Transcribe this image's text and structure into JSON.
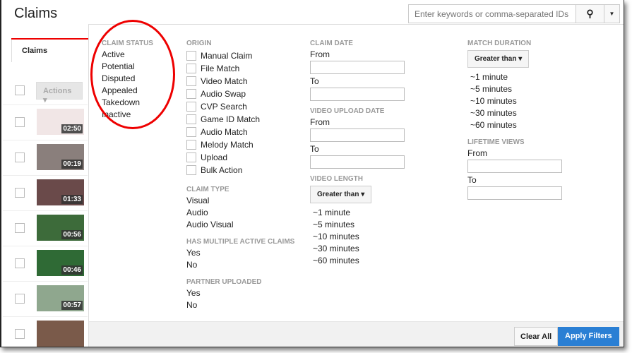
{
  "header": {
    "title": "Claims",
    "search_placeholder": "Enter keywords or comma-separated IDs",
    "search_icon": "search-icon",
    "dropdown_icon": "caret-down-icon"
  },
  "tabs": [
    {
      "label": "Claims"
    }
  ],
  "list": {
    "actions_label": "Actions ▾",
    "rows": [
      {
        "duration": "02:50",
        "color": "#f1e6e6"
      },
      {
        "duration": "00:19",
        "color": "#8a7f7c"
      },
      {
        "duration": "01:33",
        "color": "#6a4a4a"
      },
      {
        "duration": "00:56",
        "color": "#3d6b3a"
      },
      {
        "duration": "00:46",
        "color": "#2f6a35"
      },
      {
        "duration": "00:57",
        "color": "#8fa78e"
      },
      {
        "duration": "",
        "color": "#7a5a4a"
      }
    ]
  },
  "filters": {
    "claim_status": {
      "heading": "CLAIM STATUS",
      "items": [
        "Active",
        "Potential",
        "Disputed",
        "Appealed",
        "Takedown",
        "Inactive"
      ]
    },
    "origin": {
      "heading": "ORIGIN",
      "items": [
        "Manual Claim",
        "File Match",
        "Video Match",
        "Audio Swap",
        "CVP Search",
        "Game ID Match",
        "Audio Match",
        "Melody Match",
        "Upload",
        "Bulk Action"
      ]
    },
    "claim_type": {
      "heading": "CLAIM TYPE",
      "items": [
        "Visual",
        "Audio",
        "Audio Visual"
      ]
    },
    "multiple_active": {
      "heading": "HAS MULTIPLE ACTIVE CLAIMS",
      "items": [
        "Yes",
        "No"
      ]
    },
    "partner_uploaded": {
      "heading": "PARTNER UPLOADED",
      "items": [
        "Yes",
        "No"
      ]
    },
    "claim_date": {
      "heading": "CLAIM DATE",
      "from": "From",
      "to": "To"
    },
    "video_upload_date": {
      "heading": "VIDEO UPLOAD DATE",
      "from": "From",
      "to": "To"
    },
    "video_length": {
      "heading": "VIDEO LENGTH",
      "select": "Greater than ▾",
      "items": [
        "~1 minute",
        "~5 minutes",
        "~10 minutes",
        "~30 minutes",
        "~60 minutes"
      ]
    },
    "match_duration": {
      "heading": "MATCH DURATION",
      "select": "Greater than ▾",
      "items": [
        "~1 minute",
        "~5 minutes",
        "~10 minutes",
        "~30 minutes",
        "~60 minutes"
      ]
    },
    "lifetime_views": {
      "heading": "LIFETIME VIEWS",
      "from": "From",
      "to": "To"
    }
  },
  "footer": {
    "clear": "Clear All",
    "apply": "Apply Filters"
  },
  "colors": {
    "accent": "#1a73c8",
    "highlight": "#e00000"
  }
}
